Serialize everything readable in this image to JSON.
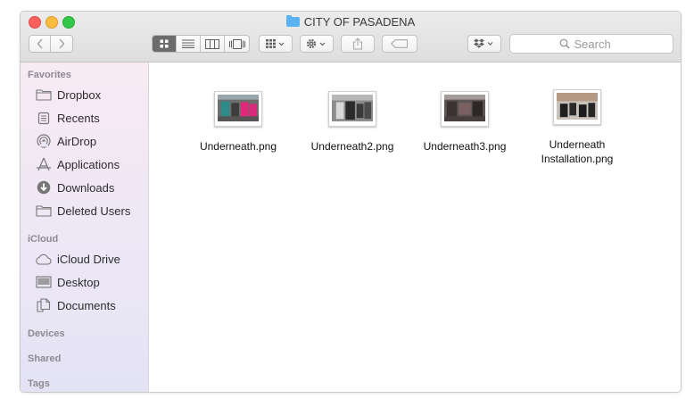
{
  "window": {
    "title": "CITY OF PASADENA"
  },
  "toolbar": {
    "back_icon": "chevron-left-icon",
    "forward_icon": "chevron-right-icon",
    "view_icons": [
      "icon-view-icon",
      "list-view-icon",
      "column-view-icon",
      "cover-flow-icon"
    ],
    "active_view": "icon-view-icon",
    "arrange_icon": "arrange-grid-icon",
    "action_icon": "gear-icon",
    "share_icon": "share-icon",
    "tag_icon": "tag-icon",
    "dropbox_icon": "dropbox-icon",
    "search_placeholder": "Search"
  },
  "sidebar": {
    "sections": [
      {
        "title": "Favorites",
        "items": [
          {
            "label": "Dropbox",
            "icon": "folder-icon"
          },
          {
            "label": "Recents",
            "icon": "recents-icon"
          },
          {
            "label": "AirDrop",
            "icon": "airdrop-icon"
          },
          {
            "label": "Applications",
            "icon": "applications-icon"
          },
          {
            "label": "Downloads",
            "icon": "downloads-icon"
          },
          {
            "label": "Deleted Users",
            "icon": "folder-icon"
          }
        ]
      },
      {
        "title": "iCloud",
        "items": [
          {
            "label": "iCloud Drive",
            "icon": "cloud-icon"
          },
          {
            "label": "Desktop",
            "icon": "desktop-icon"
          },
          {
            "label": "Documents",
            "icon": "documents-icon"
          }
        ]
      },
      {
        "title": "Devices",
        "items": []
      },
      {
        "title": "Shared",
        "items": []
      },
      {
        "title": "Tags",
        "items": []
      }
    ]
  },
  "files": [
    {
      "name": "Underneath.png"
    },
    {
      "name": "Underneath2.png"
    },
    {
      "name": "Underneath3.png"
    },
    {
      "name": "Underneath Installation.png"
    }
  ],
  "colors": {
    "close": "#fc605c",
    "minimize": "#fdbc40",
    "maximize": "#34c84a",
    "folder_blue": "#5ab2f0",
    "sidebar_top": "#f7eaf3",
    "sidebar_bottom": "#e4e3f4"
  }
}
